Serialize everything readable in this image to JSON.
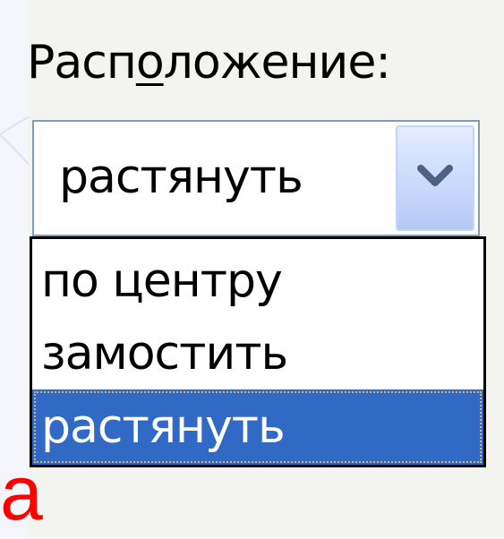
{
  "field_label": {
    "before": "Расп",
    "accel": "о",
    "after": "ложение:"
  },
  "combo": {
    "value": "растянуть",
    "button_icon": "chevron-down-icon"
  },
  "dropdown": {
    "options": [
      {
        "label": "по центру",
        "selected": false
      },
      {
        "label": "замостить",
        "selected": false
      },
      {
        "label": "растянуть",
        "selected": true
      }
    ]
  },
  "background_text": "а",
  "colors": {
    "selection": "#316ac5",
    "combo_border": "#7f9db9",
    "background_text": "#ff0000"
  }
}
